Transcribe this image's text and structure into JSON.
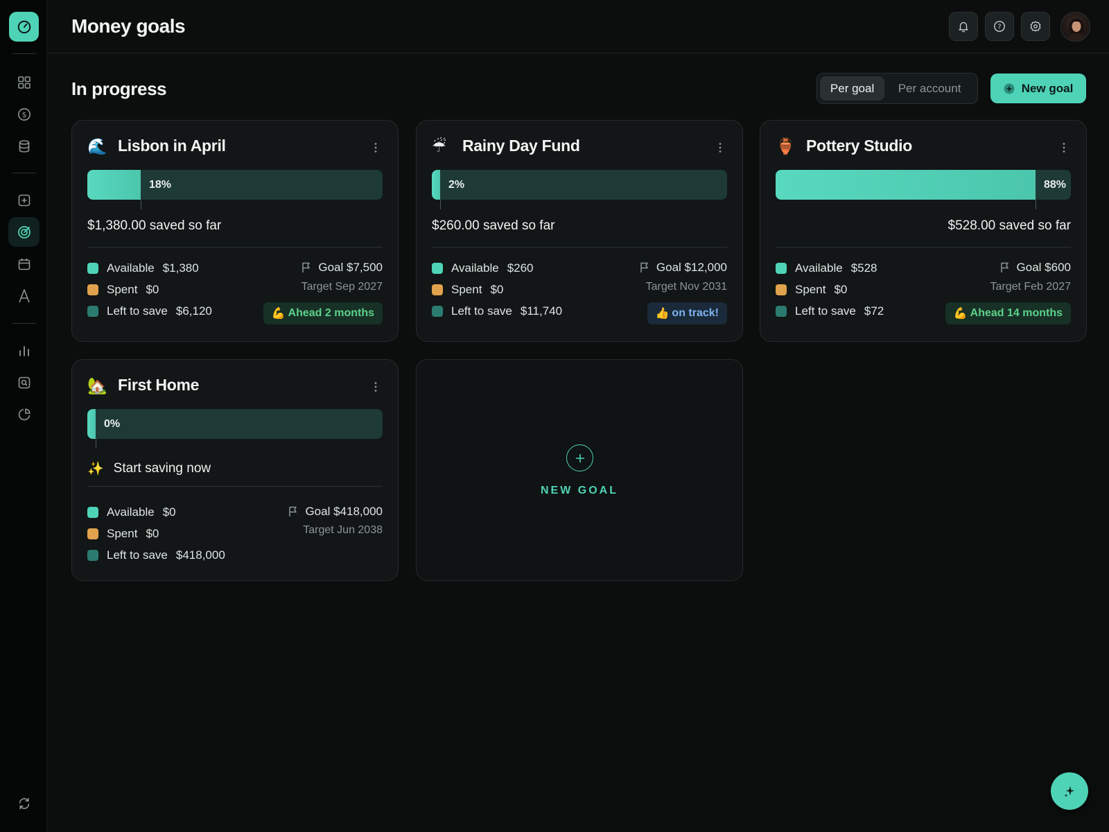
{
  "header": {
    "title": "Money goals"
  },
  "section": {
    "title": "In progress",
    "view_toggle": {
      "per_goal": "Per goal",
      "per_account": "Per account",
      "selected": "Per goal"
    },
    "new_goal_button": "New goal"
  },
  "colors": {
    "accent": "#4fd3b7",
    "available": "#4fd3b7",
    "spent": "#e0a24c",
    "left_to_save": "#2b7b70"
  },
  "cards": [
    {
      "emoji": "🌊",
      "title": "Lisbon in April",
      "progress": 0.18,
      "pct_label": "18%",
      "saved": "$1,380.00 saved so far",
      "stats": {
        "available_label": "Available",
        "available": "$1,380",
        "spent_label": "Spent",
        "spent": "$0",
        "left_label": "Left to save",
        "left": "$6,120"
      },
      "goal": "Goal $7,500",
      "target": "Target Sep 2027",
      "badge": {
        "emoji": "💪",
        "text": "Ahead 2 months",
        "tone": "green"
      }
    },
    {
      "emoji": "☔",
      "title": "Rainy Day Fund",
      "progress": 0.02,
      "pct_label": "2%",
      "saved": "$260.00 saved so far",
      "stats": {
        "available_label": "Available",
        "available": "$260",
        "spent_label": "Spent",
        "spent": "$0",
        "left_label": "Left to save",
        "left": "$11,740"
      },
      "goal": "Goal $12,000",
      "target": "Target Nov 2031",
      "badge": {
        "emoji": "👍",
        "text": "on track!",
        "tone": "blue"
      }
    },
    {
      "emoji": "🏺",
      "title": "Pottery Studio",
      "progress": 0.88,
      "pct_label": "88%",
      "saved": "$528.00 saved so far",
      "stats": {
        "available_label": "Available",
        "available": "$528",
        "spent_label": "Spent",
        "spent": "$0",
        "left_label": "Left to save",
        "left": "$72"
      },
      "goal": "Goal $600",
      "target": "Target Feb 2027",
      "badge": {
        "emoji": "💪",
        "text": "Ahead 14 months",
        "tone": "green"
      }
    },
    {
      "emoji": "🏡",
      "title": "First Home",
      "progress": 0.0,
      "pct_label": "0%",
      "start_saving": {
        "emoji": "✨",
        "text": "Start saving now"
      },
      "stats": {
        "available_label": "Available",
        "available": "$0",
        "spent_label": "Spent",
        "spent": "$0",
        "left_label": "Left to save",
        "left": "$418,000"
      },
      "goal": "Goal $418,000",
      "target": "Target Jun 2038"
    }
  ],
  "add_card": {
    "label": "NEW GOAL"
  }
}
